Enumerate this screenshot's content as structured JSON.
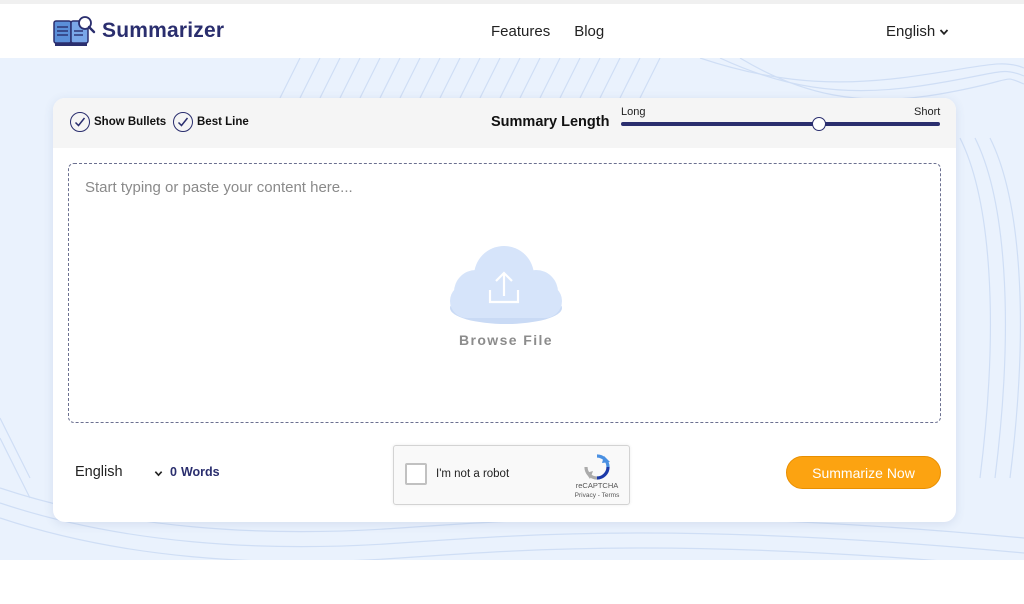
{
  "header": {
    "brand": "Summarizer",
    "logo_icon": "book-magnifier-icon",
    "nav": [
      {
        "label": "Features"
      },
      {
        "label": "Blog"
      }
    ],
    "language": "English",
    "language_icon": "chevron-down-icon"
  },
  "options": {
    "show_bullets": {
      "label": "Show Bullets",
      "checked": true,
      "icon": "check-circle-icon"
    },
    "best_line": {
      "label": "Best Line",
      "checked": true,
      "icon": "check-circle-icon"
    }
  },
  "summary_length": {
    "label": "Summary Length",
    "min_label": "Long",
    "max_label": "Short",
    "value": 0.62
  },
  "editor": {
    "placeholder": "Start typing or paste your content here...",
    "upload_icon": "cloud-upload-icon",
    "browse_label": "Browse File"
  },
  "footer": {
    "language": "English",
    "word_count": "0",
    "word_label": "Words"
  },
  "captcha": {
    "label": "I'm not a robot",
    "brand": "reCAPTCHA",
    "links": "Privacy - Terms"
  },
  "actions": {
    "summarize_label": "Summarize Now"
  },
  "colors": {
    "brand": "#2a2e6e",
    "accent": "#fca311",
    "hero_bg": "#eaf2fd",
    "cloud": "#d6e4fa"
  }
}
